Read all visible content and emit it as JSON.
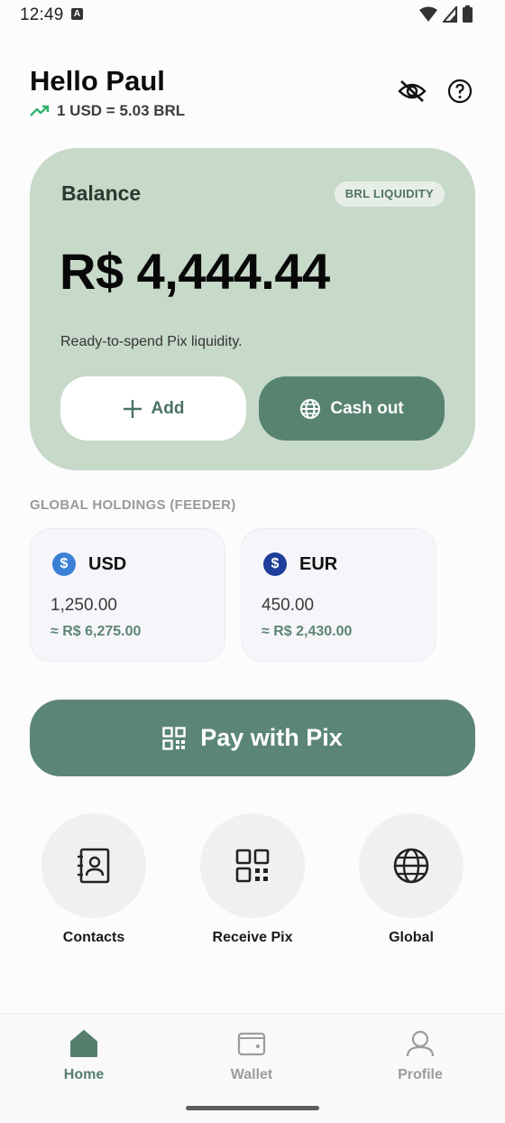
{
  "status_bar": {
    "time": "12:49",
    "notif": "A"
  },
  "header": {
    "greeting": "Hello Paul",
    "rate": "1 USD = 5.03 BRL",
    "trend_color": "#2fb36b",
    "hide_icon": "eye-off-icon",
    "help_icon": "help-icon"
  },
  "balance": {
    "label": "Balance",
    "badge": "BRL LIQUIDITY",
    "amount": "R$ 4,444.44",
    "description": "Ready-to-spend Pix liquidity.",
    "add_label": "Add",
    "cashout_label": "Cash out",
    "card_color": "#c7d9c9",
    "accent": "#588371"
  },
  "holdings": {
    "title": "GLOBAL HOLDINGS (FEEDER)",
    "items": [
      {
        "code": "USD",
        "symbol": "$",
        "amount": "1,250.00",
        "converted": "≈ R$ 6,275.00",
        "coin_color": "#3a80d6"
      },
      {
        "code": "EUR",
        "symbol": "$",
        "amount": "450.00",
        "converted": "≈ R$ 2,430.00",
        "coin_color": "#1f3d9a"
      }
    ]
  },
  "pay": {
    "label": "Pay with Pix"
  },
  "quick_actions": [
    {
      "label": "Contacts",
      "icon": "contacts-icon"
    },
    {
      "label": "Receive Pix",
      "icon": "qr-code-icon"
    },
    {
      "label": "Global",
      "icon": "globe-icon"
    }
  ],
  "nav": [
    {
      "label": "Home",
      "icon": "home-icon",
      "active": true
    },
    {
      "label": "Wallet",
      "icon": "wallet-icon",
      "active": false
    },
    {
      "label": "Profile",
      "icon": "profile-icon",
      "active": false
    }
  ]
}
